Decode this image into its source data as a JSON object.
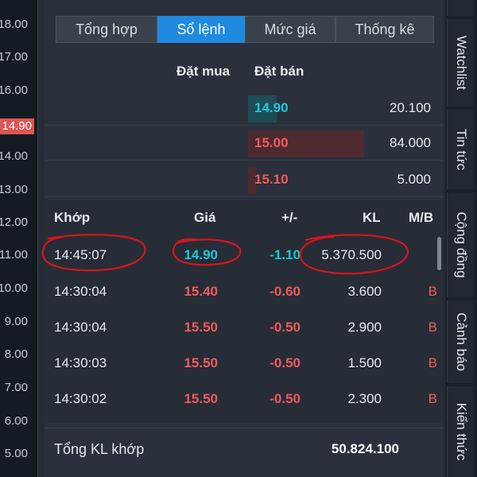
{
  "axis": {
    "labels": [
      "18.00",
      "17.00",
      "16.00",
      "14.90",
      "14.00",
      "13.00",
      "12.00",
      "11.00",
      "10.00",
      "9.00",
      "8.00",
      "7.00",
      "6.00",
      "5.00"
    ],
    "current": "14.90"
  },
  "tabs": [
    {
      "label": "Tổng hợp",
      "active": false
    },
    {
      "label": "Sổ lệnh",
      "active": true
    },
    {
      "label": "Mức giá",
      "active": false
    },
    {
      "label": "Thống kê",
      "active": false
    }
  ],
  "order_book": {
    "bid_header": "Đặt mua",
    "ask_header": "Đặt bán",
    "rows": [
      {
        "price": "14.90",
        "volume": "20.100",
        "color": "#1cc9d6",
        "bar_color": "#1e4d57"
      },
      {
        "price": "15.00",
        "volume": "84.000",
        "color": "#f05a5a",
        "bar_color": "#4d2a30"
      },
      {
        "price": "15.10",
        "volume": "5.000",
        "color": "#f05a5a",
        "bar_color": "#4d2a30"
      }
    ]
  },
  "trades": {
    "headers": {
      "time": "Khớp",
      "price": "Giá",
      "change": "+/-",
      "volume": "KL",
      "side": "M/B"
    },
    "rows": [
      {
        "time": "14:45:07",
        "price": "14.90",
        "change": "-1.10",
        "volume": "5.370.500",
        "side": ""
      },
      {
        "time": "14:30:04",
        "price": "15.40",
        "change": "-0.60",
        "volume": "3.600",
        "side": "B"
      },
      {
        "time": "14:30:04",
        "price": "15.50",
        "change": "-0.50",
        "volume": "2.900",
        "side": "B"
      },
      {
        "time": "14:30:03",
        "price": "15.50",
        "change": "-0.50",
        "volume": "1.500",
        "side": "B"
      },
      {
        "time": "14:30:02",
        "price": "15.50",
        "change": "-0.50",
        "volume": "2.300",
        "side": "B"
      }
    ]
  },
  "total": {
    "label": "Tổng KL khớp",
    "value": "50.824.100"
  },
  "vertical_tabs": [
    "Watchlist",
    "Tin tức",
    "Cộng đồng",
    "Cảnh báo",
    "Kiến thức"
  ],
  "colors": {
    "accent": "#1f8ae0",
    "down": "#f05a5a",
    "reference": "#1cc9d6",
    "annotation": "#d8141c"
  }
}
